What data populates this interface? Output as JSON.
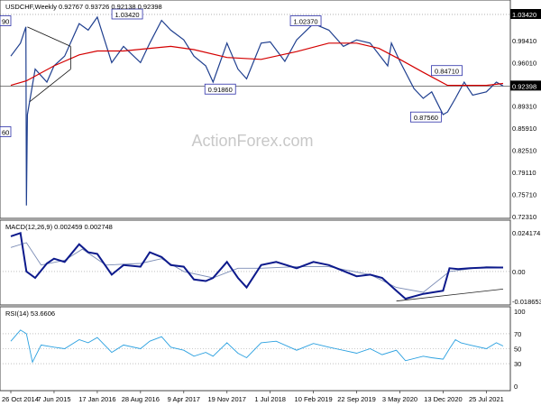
{
  "colors": {
    "background": "#ffffff",
    "price": "#1f3f8f",
    "sma": "#d40000",
    "macd": "#0d1a8c",
    "signal": "#7b8cb5",
    "rsi": "#2aa0e0",
    "trendline": "#222222",
    "label_box": "#2b2fa8",
    "current_tag": "#000000",
    "grid": "#dcdcdc",
    "watermark": "#c8c8c8"
  },
  "watermark": "ActionForex.com",
  "chart_data": [
    {
      "type": "line",
      "title": "USDCHF,Weekly  0.92767 0.93726 0.92138 0.92398",
      "y_ticks": [
        "1.03420",
        "0.99410",
        "0.96010",
        "0.92398",
        "0.89310",
        "0.85910",
        "0.82510",
        "0.79110",
        "0.75710",
        "0.72310"
      ],
      "ylim": [
        0.7231,
        1.0342
      ],
      "current_price": "0.92398",
      "left_partial_labels": [
        "90",
        "60"
      ],
      "annotations": [
        "1.03420",
        "1.02370",
        "0.91860",
        "0.84710",
        "0.87560"
      ],
      "series": [
        {
          "role": "price",
          "x": [
            "2014-10-26",
            "2014-12-15",
            "2015-01-12",
            "2015-01-15",
            "2015-01-20",
            "2015-03-01",
            "2015-05-01",
            "2015-06-07",
            "2015-08-01",
            "2015-10-15",
            "2015-12-01",
            "2016-01-17",
            "2016-04-01",
            "2016-06-01",
            "2016-08-28",
            "2016-10-15",
            "2016-12-15",
            "2017-02-01",
            "2017-04-09",
            "2017-06-01",
            "2017-08-01",
            "2017-09-08",
            "2017-11-19",
            "2018-01-15",
            "2018-03-01",
            "2018-05-15",
            "2018-07-01",
            "2018-09-15",
            "2018-11-15",
            "2019-02-10",
            "2019-05-01",
            "2019-07-15",
            "2019-09-22",
            "2019-12-01",
            "2020-03-01",
            "2020-03-20",
            "2020-05-03",
            "2020-07-15",
            "2020-09-01",
            "2020-10-15",
            "2020-12-13",
            "2021-01-05",
            "2021-02-15",
            "2021-04-01",
            "2021-05-15",
            "2021-07-25",
            "2021-09-15",
            "2021-10-20"
          ],
          "values": [
            0.97,
            0.99,
            1.015,
            0.74,
            0.88,
            0.95,
            0.93,
            0.955,
            0.97,
            1.02,
            1.01,
            1.03,
            0.96,
            0.985,
            0.96,
            0.99,
            1.025,
            1.01,
            0.995,
            0.97,
            0.955,
            0.93,
            0.99,
            0.95,
            0.935,
            0.99,
            0.992,
            0.962,
            0.995,
            1.02,
            1.01,
            0.985,
            0.995,
            0.99,
            0.955,
            0.99,
            0.962,
            0.92,
            0.905,
            0.915,
            0.88,
            0.884,
            0.905,
            0.93,
            0.91,
            0.915,
            0.93,
            0.924
          ]
        },
        {
          "role": "sma",
          "x": [
            "2014-10-26",
            "2015-01-15",
            "2015-06-07",
            "2015-10-15",
            "2016-01-17",
            "2016-06-01",
            "2016-10-15",
            "2017-02-01",
            "2017-06-01",
            "2017-11-19",
            "2018-05-15",
            "2018-11-15",
            "2019-05-01",
            "2019-09-22",
            "2020-01-15",
            "2020-05-03",
            "2020-09-01",
            "2021-01-05",
            "2021-07-25",
            "2021-10-20"
          ],
          "values": [
            0.925,
            0.932,
            0.955,
            0.972,
            0.978,
            0.978,
            0.982,
            0.985,
            0.98,
            0.968,
            0.965,
            0.977,
            0.99,
            0.99,
            0.982,
            0.965,
            0.945,
            0.925,
            0.925,
            0.928
          ]
        }
      ]
    },
    {
      "type": "line",
      "title": "MACD(12,26,9)  0.002459 0.002748",
      "y_ticks": [
        "0.024174",
        "0.00",
        "-0.018653"
      ],
      "ylim": [
        -0.018653,
        0.024174
      ],
      "series": [
        {
          "role": "macd",
          "x": [
            "2014-10-26",
            "2014-12-15",
            "2015-01-15",
            "2015-03-01",
            "2015-05-01",
            "2015-06-07",
            "2015-08-01",
            "2015-10-15",
            "2015-12-01",
            "2016-01-17",
            "2016-04-01",
            "2016-06-01",
            "2016-08-28",
            "2016-10-15",
            "2016-12-15",
            "2017-02-01",
            "2017-04-09",
            "2017-06-01",
            "2017-08-01",
            "2017-09-08",
            "2017-11-19",
            "2018-01-15",
            "2018-03-01",
            "2018-05-15",
            "2018-08-01",
            "2018-11-15",
            "2019-02-10",
            "2019-05-01",
            "2019-09-22",
            "2019-12-01",
            "2020-02-01",
            "2020-04-15",
            "2020-06-01",
            "2020-09-01",
            "2020-12-13",
            "2021-01-15",
            "2021-03-01",
            "2021-05-01",
            "2021-07-25",
            "2021-09-15",
            "2021-10-20"
          ],
          "values": [
            0.022,
            0.024,
            0.0,
            -0.004,
            0.005,
            0.008,
            0.006,
            0.017,
            0.012,
            0.011,
            -0.002,
            0.004,
            0.003,
            0.012,
            0.009,
            0.004,
            0.003,
            -0.005,
            -0.006,
            -0.004,
            0.006,
            -0.004,
            -0.01,
            0.004,
            0.006,
            0.002,
            0.006,
            0.004,
            -0.003,
            -0.002,
            -0.004,
            -0.012,
            -0.017,
            -0.014,
            -0.012,
            0.002,
            0.0015,
            0.002,
            0.0025,
            0.0025,
            0.0025
          ]
        },
        {
          "role": "signal",
          "x": [
            "2014-10-26",
            "2015-01-15",
            "2015-04-01",
            "2015-08-01",
            "2015-11-01",
            "2016-03-01",
            "2016-08-28",
            "2016-12-15",
            "2017-04-09",
            "2017-09-08",
            "2018-01-15",
            "2018-05-15",
            "2018-11-15",
            "2019-05-01",
            "2019-12-01",
            "2020-04-15",
            "2020-09-01",
            "2021-01-15",
            "2021-07-25",
            "2021-10-20"
          ],
          "values": [
            0.015,
            0.018,
            0.004,
            0.007,
            0.014,
            0.004,
            0.005,
            0.008,
            0.0,
            -0.004,
            0.002,
            0.002,
            0.003,
            0.003,
            -0.002,
            -0.01,
            -0.013,
            0.0,
            0.003,
            0.0027
          ]
        },
        {
          "role": "trendline",
          "x": [
            "2020-04-15",
            "2021-10-20"
          ],
          "values": [
            -0.0185,
            -0.011
          ]
        }
      ]
    },
    {
      "type": "line",
      "title": "RSI(14)  53.6606",
      "y_ticks": [
        "100",
        "70",
        "50",
        "30",
        "0"
      ],
      "ylim": [
        0,
        100
      ],
      "series": [
        {
          "role": "rsi",
          "x": [
            "2014-10-26",
            "2014-12-15",
            "2015-01-15",
            "2015-02-15",
            "2015-04-01",
            "2015-06-07",
            "2015-08-01",
            "2015-10-15",
            "2015-12-01",
            "2016-01-17",
            "2016-04-01",
            "2016-06-01",
            "2016-08-28",
            "2016-10-15",
            "2016-12-15",
            "2017-02-01",
            "2017-04-09",
            "2017-06-01",
            "2017-08-01",
            "2017-09-08",
            "2017-11-19",
            "2018-01-15",
            "2018-03-01",
            "2018-05-15",
            "2018-08-01",
            "2018-11-15",
            "2019-02-10",
            "2019-05-01",
            "2019-09-22",
            "2019-12-01",
            "2020-02-01",
            "2020-04-15",
            "2020-06-01",
            "2020-09-01",
            "2020-10-15",
            "2020-12-13",
            "2021-01-15",
            "2021-02-15",
            "2021-03-15",
            "2021-05-01",
            "2021-07-25",
            "2021-09-15",
            "2021-10-20"
          ],
          "values": [
            60,
            75,
            70,
            32,
            55,
            52,
            50,
            62,
            58,
            65,
            45,
            55,
            50,
            60,
            66,
            52,
            48,
            40,
            45,
            40,
            58,
            44,
            38,
            58,
            60,
            48,
            57,
            52,
            44,
            50,
            42,
            48,
            34,
            40,
            38,
            36,
            50,
            62,
            58,
            55,
            50,
            58,
            53.6606
          ]
        }
      ]
    }
  ],
  "x_axis_labels": [
    "26 Oct 2014",
    "7 Jun 2015",
    "17 Jan 2016",
    "28 Aug 2016",
    "9 Apr 2017",
    "19 Nov 2017",
    "1 Jul 2018",
    "10 Feb 2019",
    "22 Sep 2019",
    "3 May 2020",
    "13 Dec 2020",
    "25 Jul 2021"
  ]
}
